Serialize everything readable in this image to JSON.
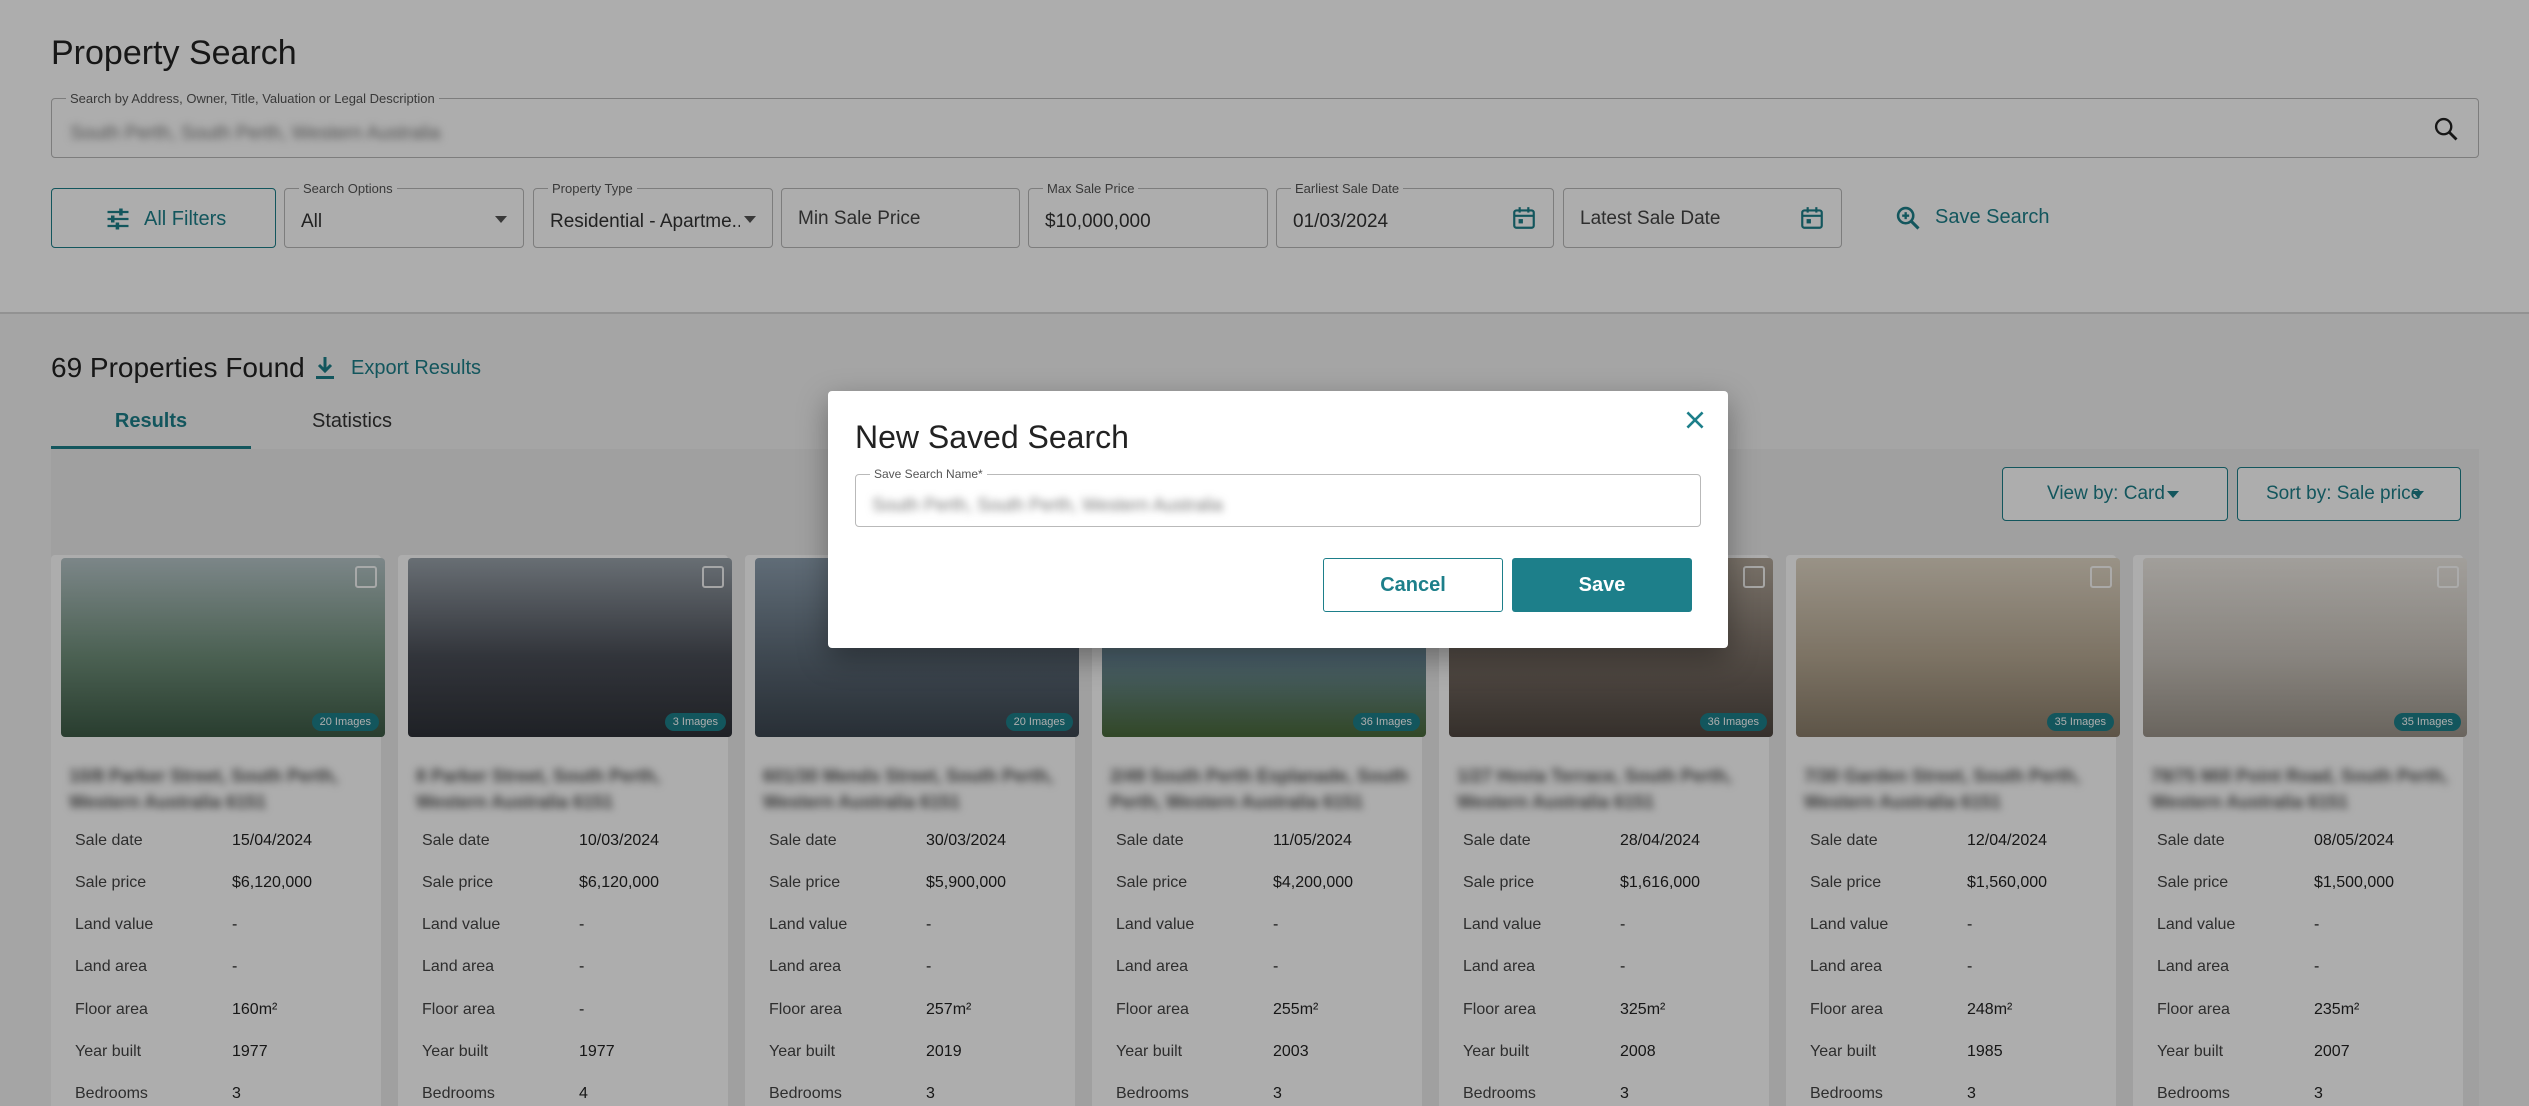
{
  "page": {
    "title": "Property Search"
  },
  "search": {
    "label": "Search by Address, Owner, Title, Valuation or Legal Description",
    "value": "South Perth, South Perth, Western Australia"
  },
  "filters": {
    "all_filters_label": "All Filters",
    "search_options": {
      "label": "Search Options",
      "value": "All"
    },
    "property_type": {
      "label": "Property Type",
      "value": "Residential - Apartme..."
    },
    "min_sale_price": {
      "placeholder": "Min Sale Price"
    },
    "max_sale_price": {
      "label": "Max Sale Price",
      "value": "$10,000,000"
    },
    "earliest_sale_date": {
      "label": "Earliest Sale Date",
      "value": "01/03/2024"
    },
    "latest_sale_date": {
      "placeholder": "Latest Sale Date"
    },
    "save_search_label": "Save Search"
  },
  "results": {
    "count_text": "69 Properties Found",
    "export_label": "Export Results",
    "tabs": [
      {
        "label": "Results"
      },
      {
        "label": "Statistics"
      }
    ],
    "view_by": "View by: Card",
    "sort_by": "Sort by: Sale price",
    "field_labels": {
      "sale_date": "Sale date",
      "sale_price": "Sale price",
      "land_value": "Land value",
      "land_area": "Land area",
      "floor_area": "Floor area",
      "year_built": "Year built",
      "bedrooms": "Bedrooms"
    },
    "cards": [
      {
        "address": "10/8 Parker Street, South Perth, Western Australia 6151",
        "images": "20 Images",
        "sale_date": "15/04/2024",
        "sale_price": "$6,120,000",
        "land_value": "-",
        "land_area": "-",
        "floor_area": "160m²",
        "year_built": "1977",
        "bedrooms": "3"
      },
      {
        "address": "8 Parker Street, South Perth, Western Australia 6151",
        "images": "3 Images",
        "sale_date": "10/03/2024",
        "sale_price": "$6,120,000",
        "land_value": "-",
        "land_area": "-",
        "floor_area": "-",
        "year_built": "1977",
        "bedrooms": "4"
      },
      {
        "address": "601/30 Mends Street, South Perth, Western Australia 6151",
        "images": "20 Images",
        "sale_date": "30/03/2024",
        "sale_price": "$5,900,000",
        "land_value": "-",
        "land_area": "-",
        "floor_area": "257m²",
        "year_built": "2019",
        "bedrooms": "3"
      },
      {
        "address": "2/49 South Perth Esplanade, South Perth, Western Australia 6151",
        "images": "36 Images",
        "sale_date": "11/05/2024",
        "sale_price": "$4,200,000",
        "land_value": "-",
        "land_area": "-",
        "floor_area": "255m²",
        "year_built": "2003",
        "bedrooms": "3"
      },
      {
        "address": "1/27 Hovia Terrace, South Perth, Western Australia 6151",
        "images": "36 Images",
        "sale_date": "28/04/2024",
        "sale_price": "$1,616,000",
        "land_value": "-",
        "land_area": "-",
        "floor_area": "325m²",
        "year_built": "2008",
        "bedrooms": "3"
      },
      {
        "address": "7/30 Garden Street, South Perth, Western Australia 6151",
        "images": "35 Images",
        "sale_date": "12/04/2024",
        "sale_price": "$1,560,000",
        "land_value": "-",
        "land_area": "-",
        "floor_area": "248m²",
        "year_built": "1985",
        "bedrooms": "3"
      },
      {
        "address": "78/75 Mill Point Road, South Perth, Western Australia 6151",
        "images": "35 Images",
        "sale_date": "08/05/2024",
        "sale_price": "$1,500,000",
        "land_value": "-",
        "land_area": "-",
        "floor_area": "235m²",
        "year_built": "2007",
        "bedrooms": "3"
      }
    ]
  },
  "modal": {
    "title": "New Saved Search",
    "field_label": "Save Search Name*",
    "field_value": "South Perth, South Perth, Western Australia",
    "cancel_label": "Cancel",
    "save_label": "Save"
  },
  "colors": {
    "accent": "#1d7f8a"
  }
}
